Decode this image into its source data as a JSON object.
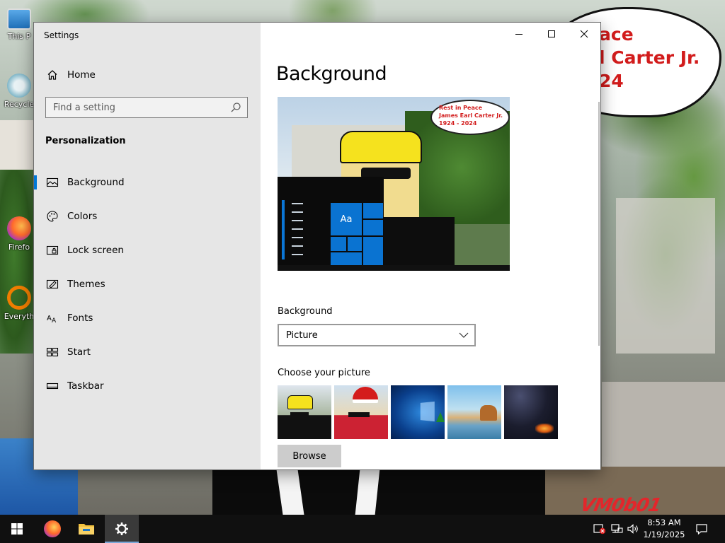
{
  "desktop": {
    "icons": [
      {
        "label": "This PC",
        "shown": "This P"
      },
      {
        "label": "Recycle Bin",
        "shown": "Recycle"
      },
      {
        "label": "Firefox",
        "shown": "Firefo"
      },
      {
        "label": "Everything",
        "shown": "Everyth"
      }
    ],
    "wallpaper_bubble_text": "ace\nl Carter Jr.\n24",
    "watermark": "VM0b01"
  },
  "window": {
    "title": "Settings",
    "caption_buttons": [
      "minimize",
      "maximize",
      "close"
    ]
  },
  "sidebar": {
    "home_label": "Home",
    "search": {
      "placeholder": "Find a setting",
      "value": ""
    },
    "section_title": "Personalization",
    "items": [
      {
        "label": "Background",
        "icon": "picture-icon",
        "selected": true
      },
      {
        "label": "Colors",
        "icon": "palette-icon",
        "selected": false
      },
      {
        "label": "Lock screen",
        "icon": "lock-screen-icon",
        "selected": false
      },
      {
        "label": "Themes",
        "icon": "themes-icon",
        "selected": false
      },
      {
        "label": "Fonts",
        "icon": "fonts-icon",
        "selected": false
      },
      {
        "label": "Start",
        "icon": "start-icon",
        "selected": false
      },
      {
        "label": "Taskbar",
        "icon": "taskbar-icon",
        "selected": false
      }
    ]
  },
  "main": {
    "page_title": "Background",
    "preview": {
      "bubble_text": "Rest in Peace\nJames Earl Carter Jr.\n1924 - 2024",
      "tile_label": "Aa"
    },
    "background_label": "Background",
    "background_select": {
      "value": "Picture"
    },
    "choose_label": "Choose your picture",
    "thumbnails": [
      "cartoon-man-sunglasses",
      "cartoon-santa-hat",
      "windows-10-hero",
      "beach-rocks",
      "night-sky-tent"
    ],
    "browse_label": "Browse"
  },
  "taskbar": {
    "apps": [
      "start",
      "firefox",
      "file-explorer",
      "settings"
    ],
    "active": "settings",
    "time": "8:53 AM",
    "date": "1/19/2025"
  },
  "colors": {
    "accent": "#0078d7",
    "sidebar_bg": "#e6e6e6",
    "taskbar_bg": "#101010"
  }
}
